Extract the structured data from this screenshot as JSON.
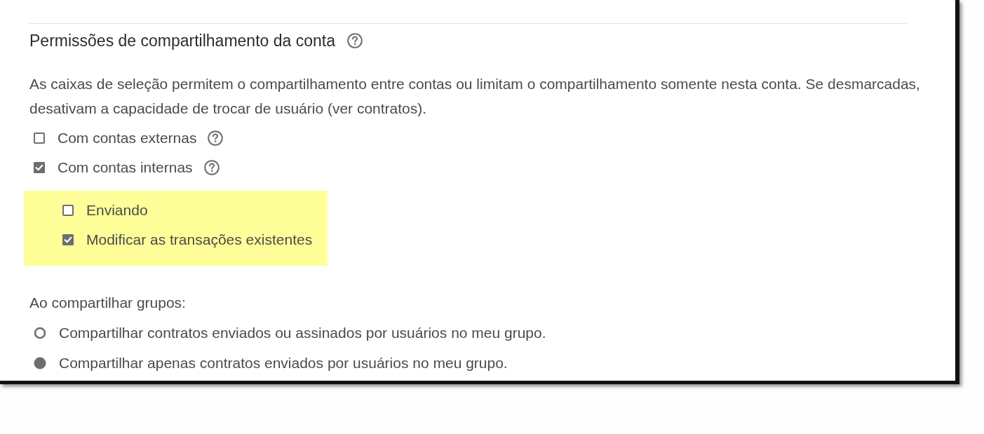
{
  "section": {
    "title": "Permissões de compartilhamento da conta",
    "description": "As caixas de seleção permitem o compartilhamento entre contas ou limitam o compartilhamento somente nesta conta. Se desmarcadas, desativam a capacidade de trocar de usuário (ver contratos)."
  },
  "sharing_options": [
    {
      "label": "Com contas externas",
      "checked": false,
      "help": true
    },
    {
      "label": "Com contas internas",
      "checked": true,
      "help": true,
      "children_highlighted": true,
      "children": [
        {
          "label": "Enviando",
          "checked": false,
          "help": false
        },
        {
          "label": "Modificar as transações existentes",
          "checked": true,
          "help": false
        }
      ]
    }
  ],
  "group_sharing": {
    "label": "Ao compartilhar grupos:",
    "options": [
      {
        "label": "Compartilhar contratos enviados ou assinados por usuários no meu grupo.",
        "selected": false
      },
      {
        "label": "Compartilhar apenas contratos enviados por usuários no meu grupo.",
        "selected": true
      }
    ]
  }
}
